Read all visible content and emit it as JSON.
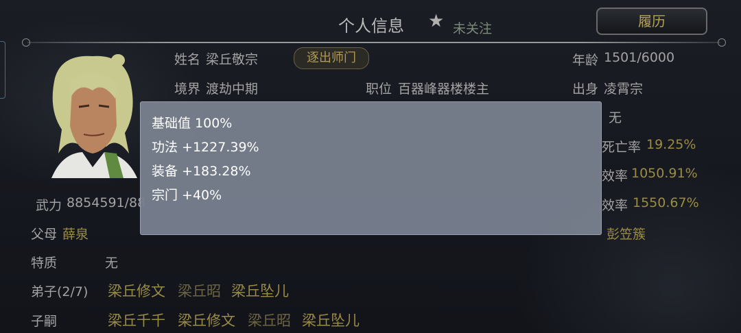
{
  "header": {
    "title": "个人信息",
    "follow_label": "未关注",
    "history_button": "履历"
  },
  "profile": {
    "name_label": "姓名",
    "name_value": "梁丘敬宗",
    "expel_button": "逐出师门",
    "age_label": "年龄",
    "age_value": "1501/6000",
    "realm_label": "境界",
    "realm_value": "渡劫中期",
    "position_label": "职位",
    "position_value": "百器峰器楼楼主",
    "origin_label": "出身",
    "origin_value": "凌霄宗",
    "right_value_row3": "无",
    "death_rate_label": "死亡率",
    "death_rate_value": "19.25%",
    "efficiency_label_1": "效率",
    "efficiency_value_1": "1050.91%",
    "efficiency_label_2": "效率",
    "efficiency_value_2": "1550.67%",
    "power_label": "武力",
    "power_value": "8854591/88",
    "parents_label": "父母",
    "parents_value": "薛泉",
    "spouse_value": "彭笠簇",
    "trait_label": "特质",
    "trait_value": "无",
    "disciples_label": "弟子(2/7)",
    "disciples": [
      "梁丘修文",
      "梁丘昭",
      "梁丘坠儿"
    ],
    "heirs_label": "子嗣",
    "heirs": [
      "梁丘千千",
      "梁丘修文",
      "梁丘昭",
      "梁丘坠儿"
    ]
  },
  "tooltip": {
    "lines": [
      "基础值 100%",
      "功法 +1227.39%",
      "装备 +183.28%",
      "宗门 +40%"
    ]
  },
  "colors": {
    "gold": "#9b8c45",
    "tooltip_bg": "#787f8e"
  }
}
